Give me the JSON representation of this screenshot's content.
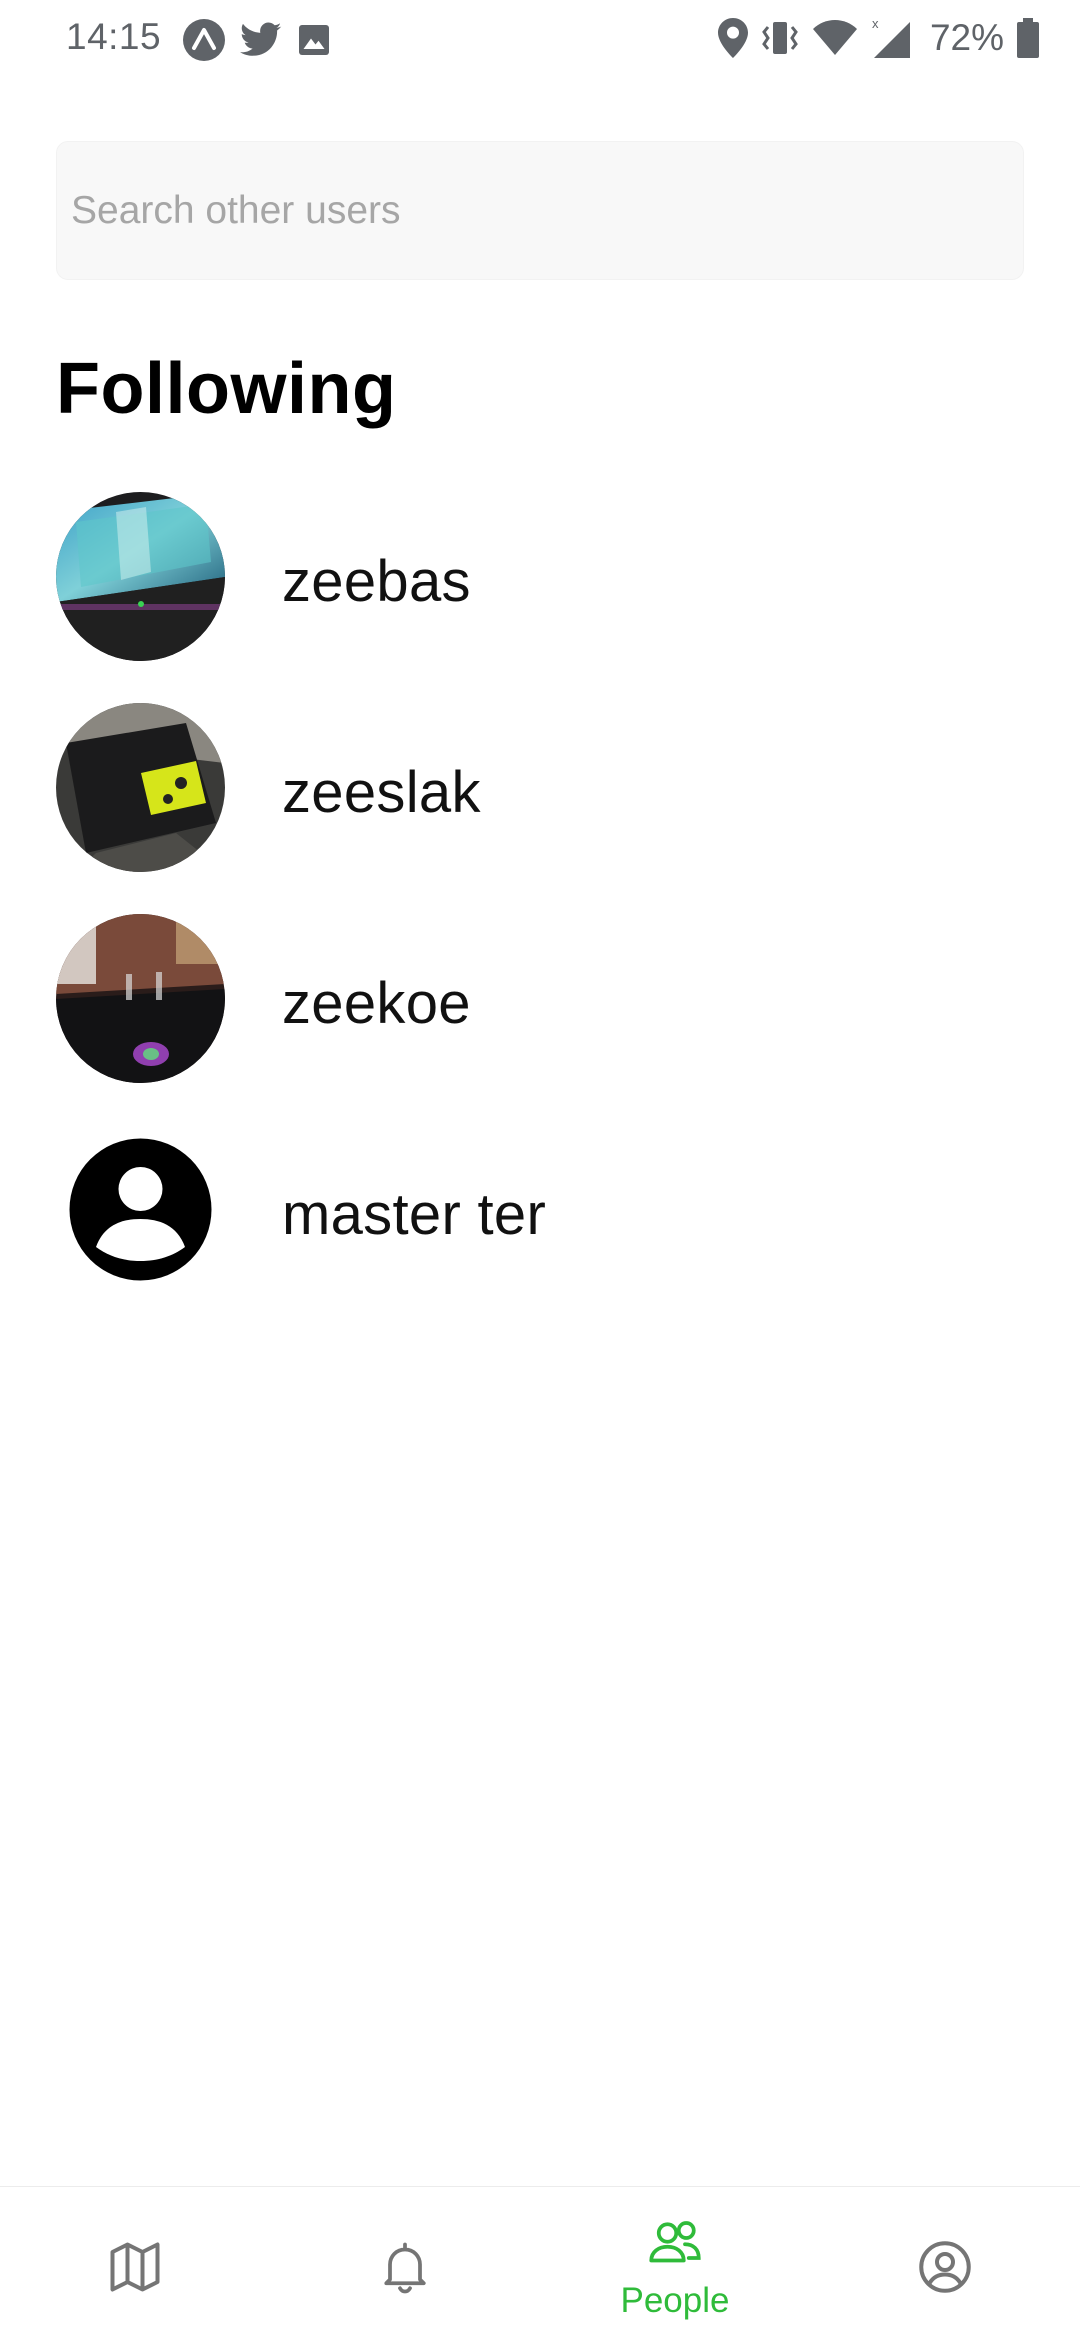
{
  "status_bar": {
    "time": "14:15",
    "battery_percent": "72%",
    "left_icons": [
      "expo-icon",
      "twitter-icon",
      "image-icon"
    ],
    "right_icons": [
      "location-icon",
      "vibrate-icon",
      "wifi-icon",
      "cell-signal-icon",
      "battery-icon"
    ]
  },
  "search": {
    "placeholder": "Search other users",
    "value": ""
  },
  "following": {
    "title": "Following",
    "users": [
      {
        "name": "zeebas",
        "avatar": "photo"
      },
      {
        "name": "zeeslak",
        "avatar": "photo"
      },
      {
        "name": "zeekoe",
        "avatar": "photo"
      },
      {
        "name": "master ter",
        "avatar": "default-user-icon"
      }
    ]
  },
  "bottom_nav": {
    "items": [
      {
        "icon": "map-icon",
        "label": "",
        "active": false
      },
      {
        "icon": "bell-icon",
        "label": "",
        "active": false
      },
      {
        "icon": "people-icon",
        "label": "People",
        "active": true
      },
      {
        "icon": "account-circle-icon",
        "label": "",
        "active": false
      }
    ],
    "active_color": "#2fbb3a",
    "inactive_color": "#757575"
  }
}
